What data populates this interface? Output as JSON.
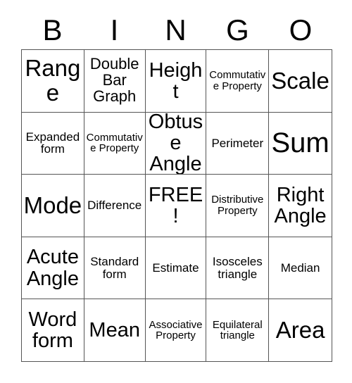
{
  "header": {
    "letters": [
      "B",
      "I",
      "N",
      "G",
      "O"
    ]
  },
  "grid": {
    "rows": [
      [
        {
          "text": "Range",
          "size": "fs-lg"
        },
        {
          "text": "Double Bar Graph",
          "size": "fs-sm"
        },
        {
          "text": "Height",
          "size": "fs-md"
        },
        {
          "text": "Commutative Property",
          "size": "fs-xxs"
        },
        {
          "text": "Scale",
          "size": "fs-lg"
        }
      ],
      [
        {
          "text": "Expanded form",
          "size": "fs-xs"
        },
        {
          "text": "Commutative Property",
          "size": "fs-xxs"
        },
        {
          "text": "Obtuse Angle",
          "size": "fs-md"
        },
        {
          "text": "Perimeter",
          "size": "fs-xs"
        },
        {
          "text": "Sum",
          "size": "fs-xl"
        }
      ],
      [
        {
          "text": "Mode",
          "size": "fs-lg"
        },
        {
          "text": "Difference",
          "size": "fs-xs"
        },
        {
          "text": "FREE!",
          "size": "fs-md"
        },
        {
          "text": "Distributive Property",
          "size": "fs-xxs"
        },
        {
          "text": "Right Angle",
          "size": "fs-md"
        }
      ],
      [
        {
          "text": "Acute Angle",
          "size": "fs-md"
        },
        {
          "text": "Standard form",
          "size": "fs-xs"
        },
        {
          "text": "Estimate",
          "size": "fs-xs"
        },
        {
          "text": "Isosceles triangle",
          "size": "fs-xs"
        },
        {
          "text": "Median",
          "size": "fs-xs"
        }
      ],
      [
        {
          "text": "Word form",
          "size": "fs-md"
        },
        {
          "text": "Mean",
          "size": "fs-md"
        },
        {
          "text": "Associative Property",
          "size": "fs-xxs"
        },
        {
          "text": "Equilateral triangle",
          "size": "fs-xxs"
        },
        {
          "text": "Area",
          "size": "fs-lg"
        }
      ]
    ]
  }
}
